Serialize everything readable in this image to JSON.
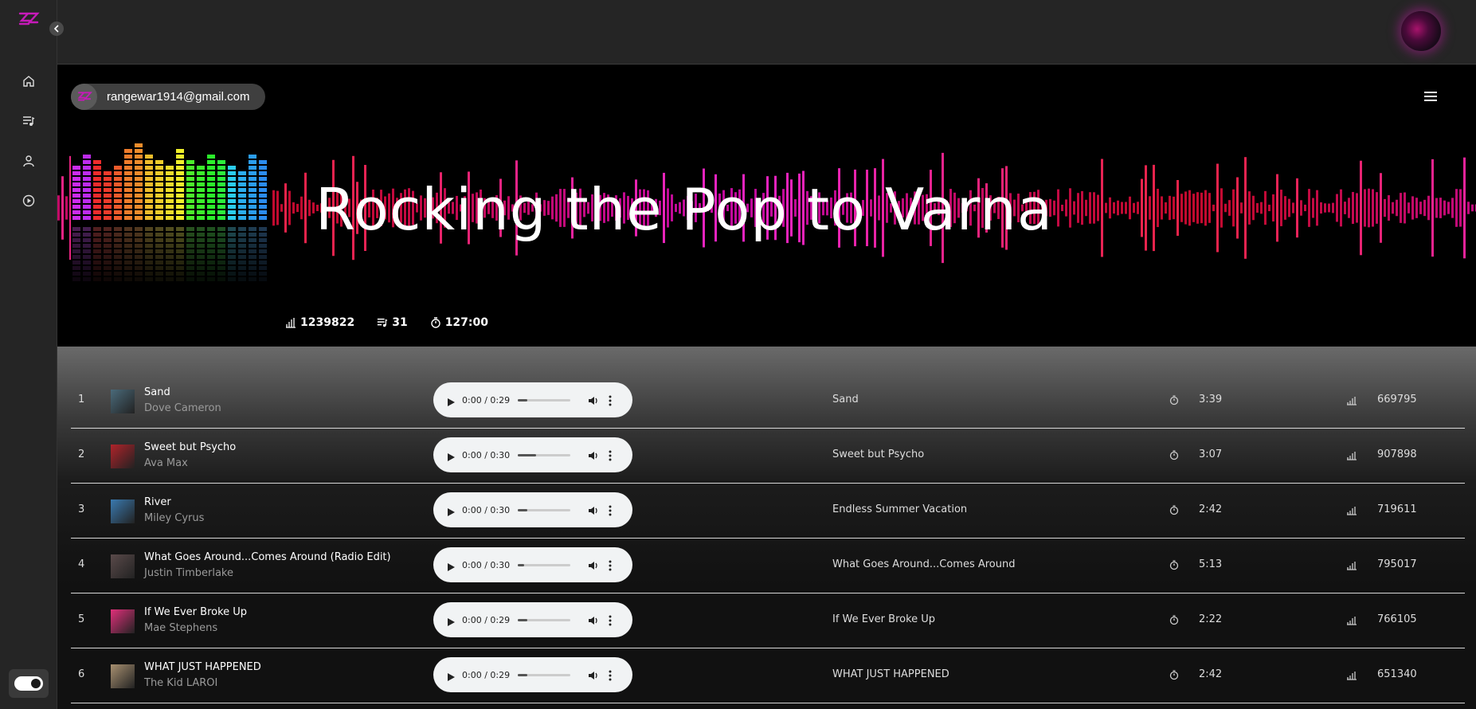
{
  "user": {
    "email": "rangewar1914@gmail.com"
  },
  "playlist": {
    "title": "Rocking the Pop to Varna",
    "plays": "1239822",
    "track_count": "31",
    "duration": "127:00"
  },
  "nav": [
    "home",
    "playlist",
    "profile",
    "player"
  ],
  "colors": {
    "accent": "#b0159e",
    "background": "#141414",
    "sidebar": "#252525"
  },
  "tracks": [
    {
      "num": "1",
      "name": "Sand",
      "artist": "Dove Cameron",
      "time": "0:00 / 0:29",
      "progress": 0.18,
      "album": "Sand",
      "duration": "3:39",
      "plays": "669795",
      "thumb": "#4a6a7a"
    },
    {
      "num": "2",
      "name": "Sweet but Psycho",
      "artist": "Ava Max",
      "time": "0:00 / 0:30",
      "progress": 0.35,
      "album": "Sweet but Psycho",
      "duration": "3:07",
      "plays": "907898",
      "thumb": "#b0232a"
    },
    {
      "num": "3",
      "name": "River",
      "artist": "Miley Cyrus",
      "time": "0:00 / 0:30",
      "progress": 0.18,
      "album": "Endless Summer Vacation",
      "duration": "2:42",
      "plays": "719611",
      "thumb": "#3a7ab0"
    },
    {
      "num": "4",
      "name": "What Goes Around...Comes Around (Radio Edit)",
      "artist": "Justin Timberlake",
      "time": "0:00 / 0:30",
      "progress": 0.12,
      "album": "What Goes Around...Comes Around",
      "duration": "5:13",
      "plays": "795017",
      "thumb": "#5a4a4a"
    },
    {
      "num": "5",
      "name": "If We Ever Broke Up",
      "artist": "Mae Stephens",
      "time": "0:00 / 0:29",
      "progress": 0.18,
      "album": "If We Ever Broke Up",
      "duration": "2:22",
      "plays": "766105",
      "thumb": "#e0307a"
    },
    {
      "num": "6",
      "name": "WHAT JUST HAPPENED",
      "artist": "The Kid LAROI",
      "time": "0:00 / 0:29",
      "progress": 0.18,
      "album": "WHAT JUST HAPPENED",
      "duration": "2:42",
      "plays": "651340",
      "thumb": "#a89070"
    }
  ]
}
